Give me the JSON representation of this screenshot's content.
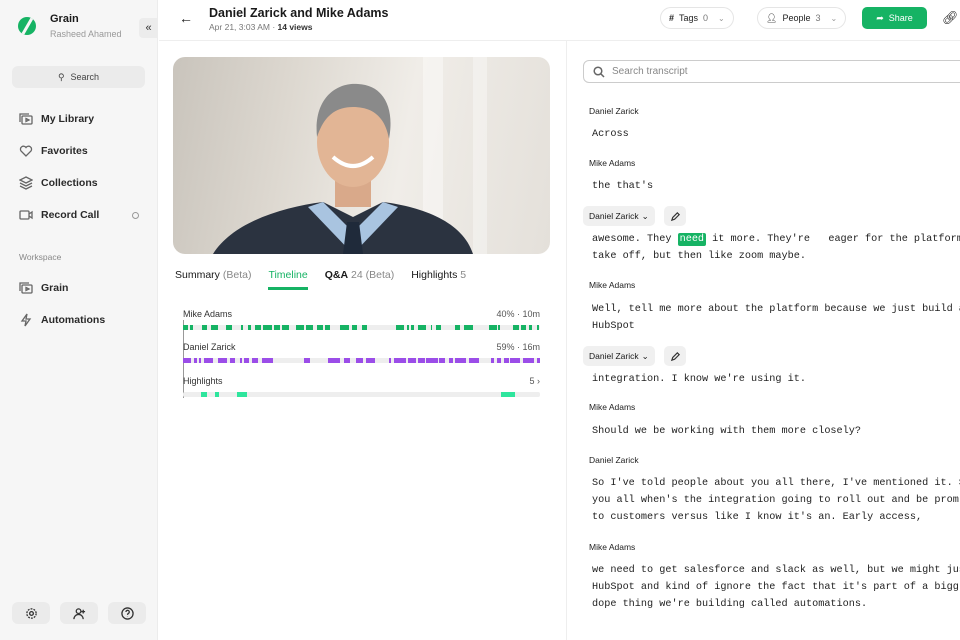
{
  "sidebar": {
    "app": "Grain",
    "user": "Rasheed Ahamed",
    "search": "Search",
    "items": [
      {
        "label": "My Library"
      },
      {
        "label": "Favorites"
      },
      {
        "label": "Collections"
      },
      {
        "label": "Record Call"
      }
    ],
    "workspace_label": "Workspace",
    "workspace_items": [
      {
        "label": "Grain"
      },
      {
        "label": "Automations"
      }
    ]
  },
  "header": {
    "title": "Daniel Zarick and Mike Adams",
    "date": "Apr 21, 3:03 AM · ",
    "views": "14 views",
    "tags_label": "Tags",
    "tags_count": "0",
    "people_label": "People",
    "people_count": "3",
    "share": "Share"
  },
  "tabs": [
    {
      "label": "Summary",
      "sub": "(Beta)"
    },
    {
      "label": "Timeline",
      "sub": ""
    },
    {
      "label": "Q&A",
      "sub": "24 (Beta)"
    },
    {
      "label": "Highlights",
      "sub": "5"
    }
  ],
  "timeline": {
    "speakers": [
      {
        "name": "Mike Adams",
        "stat": "40% · 10m",
        "percent": 40,
        "color": "#16b364"
      },
      {
        "name": "Daniel Zarick",
        "stat": "59% · 16m",
        "percent": 59,
        "color": "#9b4de8"
      }
    ],
    "highlights_label": "Highlights",
    "highlights_count": "5",
    "highlight_color": "#2ee59d"
  },
  "transcript": {
    "placeholder": "Search transcript",
    "entries": [
      {
        "speaker": "Daniel Zarick",
        "text": "Across"
      },
      {
        "speaker": "Mike Adams",
        "text": "the that's"
      },
      {
        "speaker": "Daniel Zarick",
        "pre": "awesome. They ",
        "highlight": "need",
        "post": " it more. They're   eager for the platform\ntake off, but then like zoom maybe."
      },
      {
        "speaker": "Mike Adams",
        "text": "Well, tell me more about the platform because we just build a\nHubSpot"
      },
      {
        "speaker": "Daniel Zarick",
        "text": "integration. I know we're using it."
      },
      {
        "speaker": "Mike Adams",
        "text": "Should we be working with them more closely?"
      },
      {
        "speaker": "Daniel Zarick",
        "text": "So I've told people about you all there, I've mentioned it. S\nyou all when's the integration going to roll out and be prom\nto customers versus like I know it's an. Early access,"
      },
      {
        "speaker": "Mike Adams",
        "text": "we need to get salesforce and slack as well, but we might jus\nHubSpot and kind of ignore the fact that it's part of a bigg\ndope thing we're building called automations."
      }
    ]
  }
}
